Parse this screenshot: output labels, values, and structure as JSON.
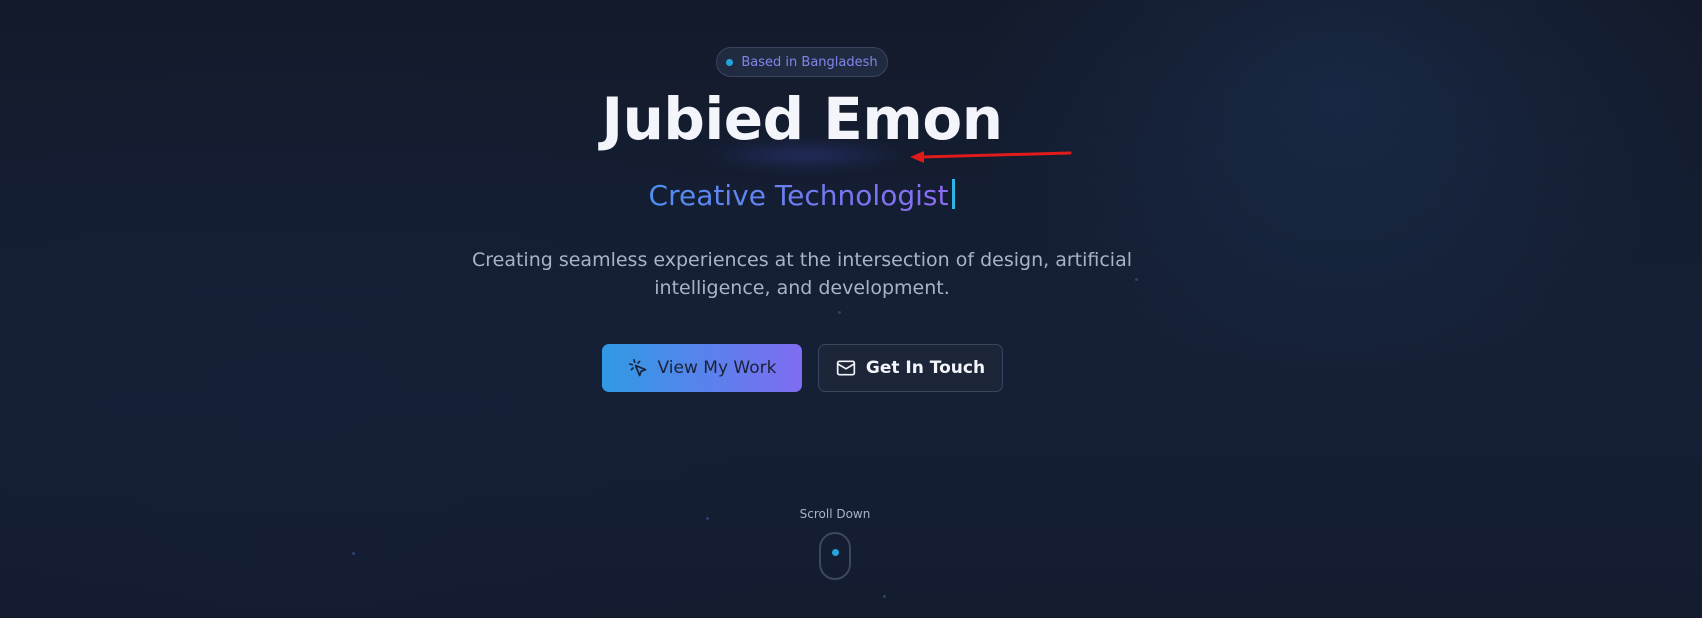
{
  "badge": {
    "text": "Based in Bangladesh",
    "dot_color": "#22a6d9"
  },
  "hero": {
    "name": "Jubied Emon",
    "role": "Creative Technologist",
    "description": "Creating seamless experiences at the intersection of design, artificial intelligence, and development."
  },
  "buttons": {
    "primary": {
      "label": "View My Work",
      "icon": "cursor-click-icon"
    },
    "secondary": {
      "label": "Get In Touch",
      "icon": "mail-icon"
    }
  },
  "scroll": {
    "label": "Scroll Down",
    "icon": "mouse-icon"
  },
  "colors": {
    "background": "#141c2e",
    "accent_blue": "#2f9ae4",
    "accent_purple": "#7f6cf2",
    "cyan": "#22a6d9",
    "annotation_arrow": "#e01b1b"
  }
}
